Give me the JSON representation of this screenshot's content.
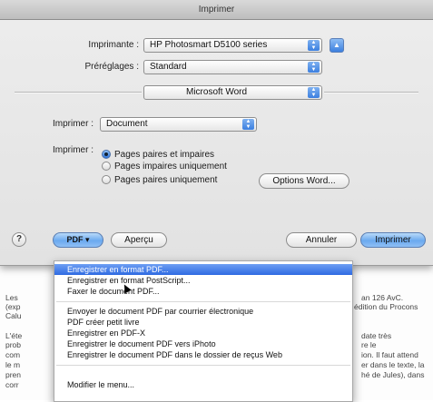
{
  "window": {
    "title": "Imprimer"
  },
  "printer": {
    "label": "Imprimante :",
    "value": "HP Photosmart D5100 series"
  },
  "presets": {
    "label": "Préréglages :",
    "value": "Standard"
  },
  "pane": {
    "value": "Microsoft Word"
  },
  "print_what": {
    "label": "Imprimer :",
    "value": "Document"
  },
  "print_pages": {
    "label": "Imprimer :",
    "options": [
      {
        "label": "Pages paires et impaires",
        "selected": true
      },
      {
        "label": "Pages impaires uniquement",
        "selected": false
      },
      {
        "label": "Pages paires uniquement",
        "selected": false
      }
    ],
    "options_button": "Options Word..."
  },
  "footer": {
    "help": "?",
    "pdf": "PDF ▾",
    "preview": "Aperçu",
    "cancel": "Annuler",
    "print": "Imprimer"
  },
  "pdf_menu": {
    "items": [
      "Enregistrer en format PDF...",
      "Enregistrer en format PostScript...",
      "Faxer le document PDF...",
      "Envoyer le document PDF par courrier électronique",
      "PDF créer petit livre",
      "Enregistrer en PDF-X",
      "Enregistrer le document PDF vers iPhoto",
      "Enregistrer le document PDF dans le dossier de reçus Web",
      "Modifier le menu..."
    ],
    "selected_index": 0
  },
  "background_text": {
    "left": [
      "Les",
      "(exp",
      "Calu",
      "L'éte",
      "prob",
      "com",
      "le m",
      "pren",
      "corr"
    ],
    "right": [
      "an 126 AvC.",
      "édition du Procons",
      "",
      "date très",
      "re le",
      "ion. Il faut attend",
      "er dans le texte, la",
      "hé de Jules), dans",
      ""
    ]
  }
}
